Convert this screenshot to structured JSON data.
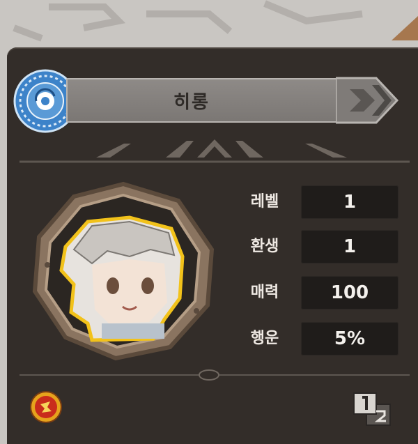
{
  "character": {
    "name": "히롱"
  },
  "stats": [
    {
      "label": "레벨",
      "value": "1"
    },
    {
      "label": "환생",
      "value": "1"
    },
    {
      "label": "매력",
      "value": "100"
    },
    {
      "label": "행운",
      "value": "5%"
    }
  ],
  "icons": {
    "emblem": "blue-rune-emblem-icon",
    "skill": "red-skill-badge-icon",
    "page": "page-toggle-1-2-icon"
  },
  "colors": {
    "panel_bg": "#332d29",
    "title_bar": "#8a8683",
    "value_box": "#1f1c1a",
    "frame_wood": "#8a7460",
    "portrait_outline": "#f2c21a"
  }
}
